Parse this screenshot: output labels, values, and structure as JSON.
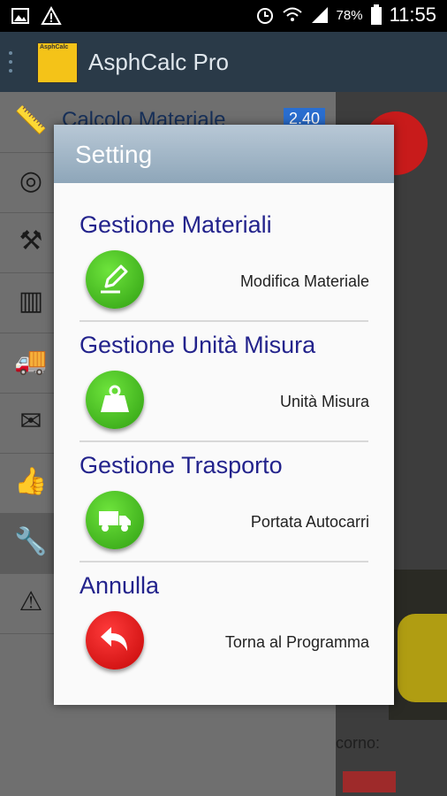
{
  "status_bar": {
    "battery_percent": "78%",
    "time": "11:55"
  },
  "app_bar": {
    "logo_text": "AsphCalc",
    "title": "AsphCalc Pro"
  },
  "drawer": {
    "items": [
      {
        "label": "Calcolo Materiale",
        "icon": "ruler-icon",
        "badge": "2.40"
      },
      {
        "label": "",
        "icon": "tape-measure-icon"
      },
      {
        "label": "",
        "icon": "worker-icon"
      },
      {
        "label": "",
        "icon": "roll-icon"
      },
      {
        "label": "",
        "icon": "truck-icon"
      },
      {
        "label": "",
        "icon": "envelope-icon"
      },
      {
        "label": "",
        "icon": "thumbs-up-icon"
      },
      {
        "label": "",
        "icon": "wrench-icon"
      },
      {
        "label": "",
        "icon": "warning-icon"
      }
    ]
  },
  "background": {
    "partial_text": "corno:"
  },
  "dialog": {
    "title": "Setting",
    "sections": [
      {
        "title": "Gestione Materiali",
        "action": "Modifica Materiale",
        "icon": "pencil-icon",
        "color": "#3db01a"
      },
      {
        "title": "Gestione Unità Misura",
        "action": "Unità Misura",
        "icon": "weight-icon",
        "color": "#3db01a"
      },
      {
        "title": "Gestione Trasporto",
        "action": "Portata Autocarri",
        "icon": "truck-icon",
        "color": "#3db01a"
      },
      {
        "title": "Annulla",
        "action": "Torna al Programma",
        "icon": "back-arrow-icon",
        "color": "#e01010"
      }
    ]
  }
}
